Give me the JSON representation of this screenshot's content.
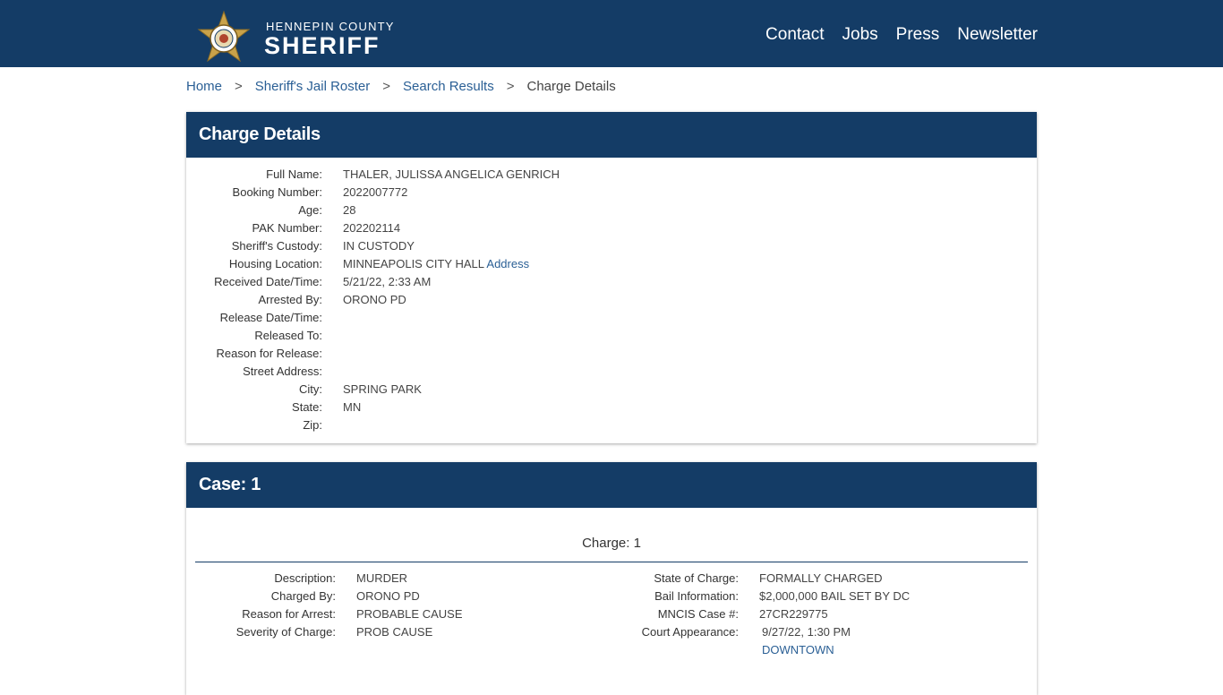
{
  "header": {
    "brand_sub": "HENNEPIN COUNTY",
    "brand_main": "SHERIFF",
    "nav": [
      "Contact",
      "Jobs",
      "Press",
      "Newsletter"
    ]
  },
  "breadcrumb": {
    "items": [
      "Home",
      "Sheriff's Jail Roster",
      "Search Results"
    ],
    "current": "Charge Details",
    "separator": ">"
  },
  "details": {
    "title": "Charge Details",
    "rows": [
      {
        "label": "Full Name:",
        "value": "THALER, JULISSA ANGELICA GENRICH"
      },
      {
        "label": "Booking Number:",
        "value": "2022007772"
      },
      {
        "label": "Age:",
        "value": "28"
      },
      {
        "label": "PAK Number:",
        "value": "202202114"
      },
      {
        "label": "Sheriff's Custody:",
        "value": "IN CUSTODY"
      },
      {
        "label": "Housing Location:",
        "value": "MINNEAPOLIS CITY HALL",
        "link": "Address"
      },
      {
        "label": "Received Date/Time:",
        "value": "5/21/22, 2:33 AM"
      },
      {
        "label": "Arrested By:",
        "value": "ORONO PD"
      },
      {
        "label": "Release Date/Time:",
        "value": ""
      },
      {
        "label": "Released To:",
        "value": ""
      },
      {
        "label": "Reason for Release:",
        "value": ""
      },
      {
        "label": "Street Address:",
        "value": ""
      },
      {
        "label": "City:",
        "value": "SPRING PARK"
      },
      {
        "label": "State:",
        "value": "MN"
      },
      {
        "label": "Zip:",
        "value": ""
      }
    ]
  },
  "case": {
    "title": "Case: 1",
    "charge_title": "Charge: 1",
    "left": [
      {
        "label": "Description:",
        "value": "MURDER"
      },
      {
        "label": "Charged By:",
        "value": "ORONO PD"
      },
      {
        "label": "Reason for Arrest:",
        "value": "PROBABLE CAUSE"
      },
      {
        "label": "Severity of Charge:",
        "value": "PROB CAUSE"
      }
    ],
    "right": [
      {
        "label": "State of Charge:",
        "value": "FORMALLY CHARGED"
      },
      {
        "label": "Bail Information:",
        "value": "$2,000,000 BAIL SET BY DC"
      },
      {
        "label": "MNCIS Case #:",
        "value": "27CR229775"
      },
      {
        "label": "Court Appearance:",
        "value": "9/27/22, 1:30 PM",
        "link": "DOWNTOWN"
      }
    ]
  },
  "colors": {
    "brand": "#143c66",
    "link": "#2a5f95",
    "star": "#c9a24a"
  }
}
